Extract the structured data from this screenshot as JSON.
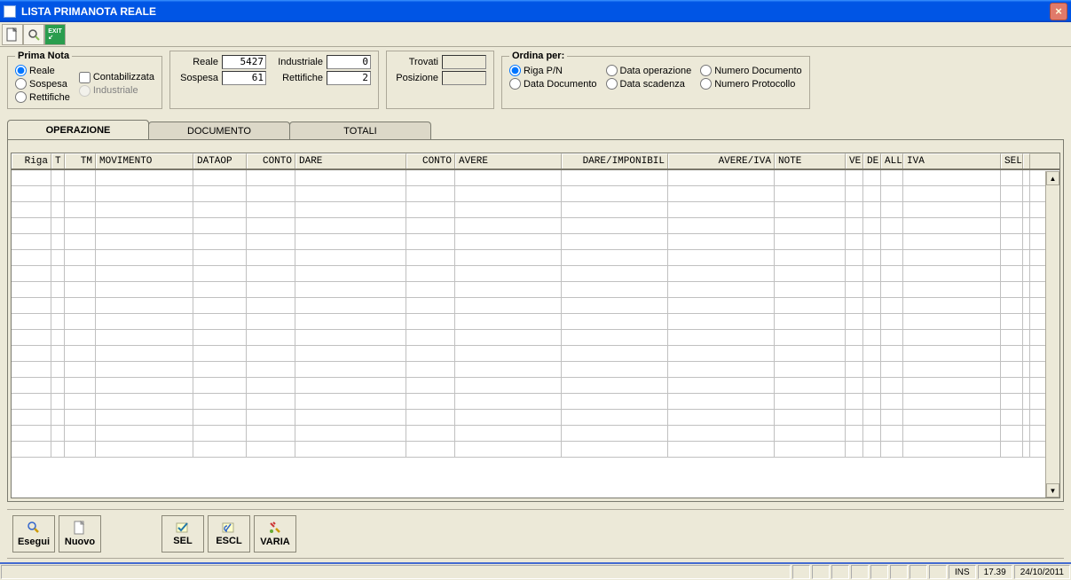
{
  "title": "LISTA PRIMANOTA REALE",
  "primaNota": {
    "legend": "Prima Nota",
    "reale": "Reale",
    "sospesa": "Sospesa",
    "rettifiche": "Rettifiche",
    "contabilizzata": "Contabilizzata",
    "industriale": "Industriale"
  },
  "counts": {
    "reale_label": "Reale",
    "reale_value": "5427",
    "sospesa_label": "Sospesa",
    "sospesa_value": "61",
    "industriale_label": "Industriale",
    "industriale_value": "0",
    "rettifiche_label": "Rettifiche",
    "rettifiche_value": "2",
    "trovati_label": "Trovati",
    "trovati_value": "",
    "posizione_label": "Posizione",
    "posizione_value": ""
  },
  "ordina": {
    "legend": "Ordina per:",
    "riga": "Riga P/N",
    "dataDoc": "Data Documento",
    "dataOp": "Data operazione",
    "dataScad": "Data scadenza",
    "numDoc": "Numero Documento",
    "numProt": "Numero Protocollo"
  },
  "tabs": {
    "operazione": "OPERAZIONE",
    "documento": "DOCUMENTO",
    "totali": "TOTALI"
  },
  "cols": {
    "riga": "Riga",
    "t": "T",
    "tm": "TM",
    "mov": "MOVIMENTO",
    "dop": "DATAOP",
    "conto": "CONTO",
    "dare": "DARE",
    "conto2": "CONTO",
    "avere": "AVERE",
    "di": "DARE/IMPONIBIL",
    "ai": "AVERE/IVA",
    "note": "NOTE",
    "ve": "VE",
    "de": "DE",
    "all": "ALL",
    "iva": "IVA",
    "sel": "SEL"
  },
  "buttons": {
    "esegui": "Esegui",
    "nuovo": "Nuovo",
    "sel": "SEL",
    "escl": "ESCL",
    "varia": "VARIA"
  },
  "status": {
    "ins": "INS",
    "time": "17.39",
    "date": "24/10/2011"
  }
}
